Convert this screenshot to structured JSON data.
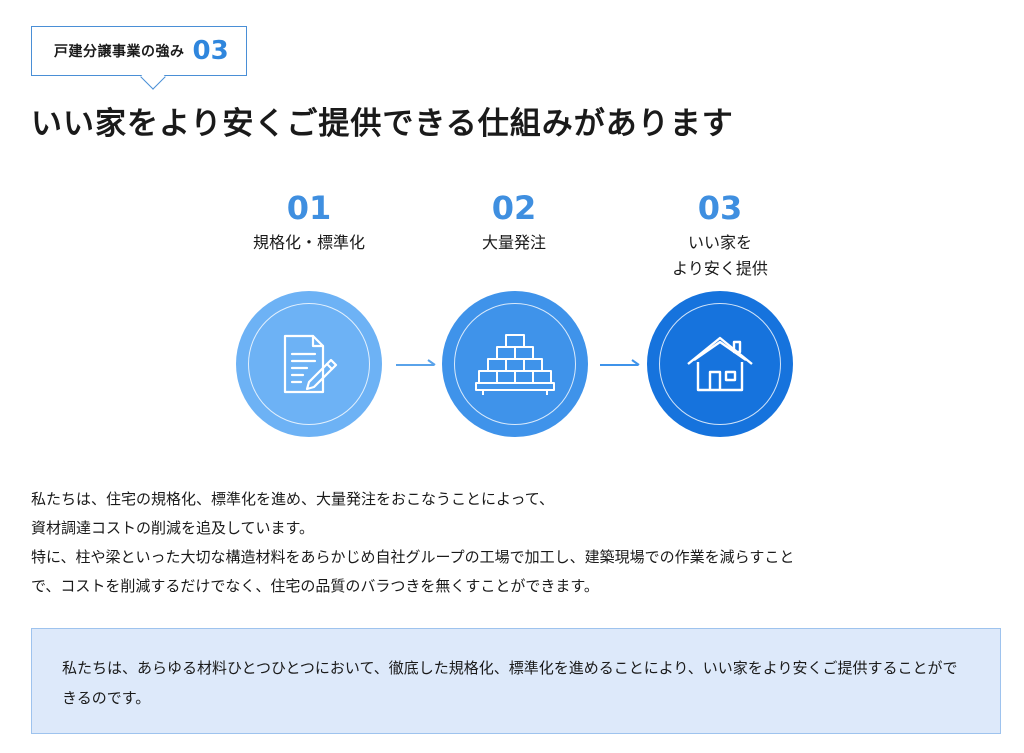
{
  "badge": {
    "label": "戸建分譲事業の強み",
    "number": "03"
  },
  "heading": "いい家をより安くご提供できる仕組みがあります",
  "steps": [
    {
      "number": "01",
      "label": "規格化・標準化",
      "icon": "document-pen-icon",
      "color": "#6db2f5"
    },
    {
      "number": "02",
      "label": "大量発注",
      "icon": "stacked-boxes-icon",
      "color": "#3f93ea"
    },
    {
      "number": "03",
      "label": "いい家を\nより安く提供",
      "icon": "house-icon",
      "color": "#1673dd"
    }
  ],
  "body": {
    "line1": "私たちは、住宅の規格化、標準化を進め、大量発注をおこなうことによって、",
    "line2": "資材調達コストの削減を追及しています。",
    "line3": "特に、柱や梁といった大切な構造材料をあらかじめ自社グループの工場で加工し、建築現場での作業を減らすこと",
    "line4": "で、コストを削減するだけでなく、住宅の品質のバラつきを無くすことができます。"
  },
  "note": "私たちは、あらゆる材料ひとつひとつにおいて、徹底した規格化、標準化を進めることにより、いい家をより安くご提供することができるのです。",
  "colors": {
    "accent": "#2f86dd",
    "note_bg": "#dde9fa",
    "note_border": "#9ec3ee"
  }
}
